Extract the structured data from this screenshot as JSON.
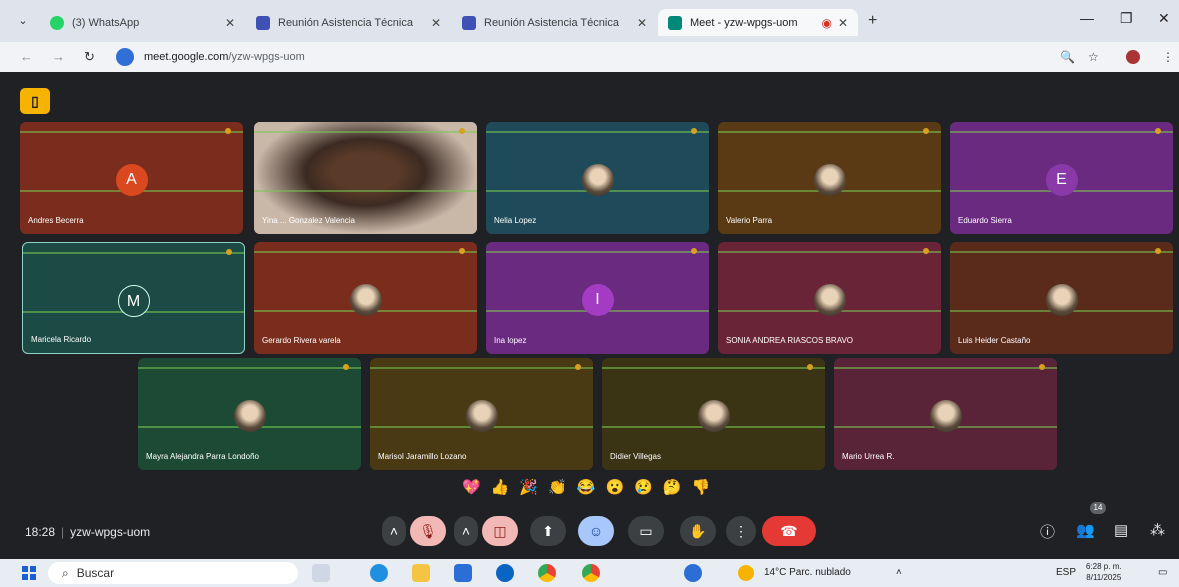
{
  "browser": {
    "tabs": [
      {
        "label": "(3) WhatsApp",
        "icon": "whatsapp-icon",
        "color": "#25d366"
      },
      {
        "label": "Reunión Asistencia Técnica",
        "icon": "calendar-icon",
        "color": "#3f51b5"
      },
      {
        "label": "Reunión Asistencia Técnica",
        "icon": "calendar-icon",
        "color": "#3f51b5"
      },
      {
        "label": "Meet - yzw-wpgs-uom",
        "icon": "meet-icon",
        "color": "#00897b"
      }
    ],
    "new_tab_label": "+",
    "url_domain": "meet.google.com",
    "url_path": "/yzw-wpgs-uom"
  },
  "meeting": {
    "time": "18:28",
    "code": "yzw-wpgs-uom",
    "participant_count": "14",
    "participants": [
      {
        "name": "Andres Becerra",
        "initial": "A",
        "bg": "#7a2d1c",
        "avatar_bg": "#d9481f"
      },
      {
        "name": "Yina ... Gonzalez Valencia",
        "initial": "",
        "bg": "#b9a89a",
        "avatar_bg": ""
      },
      {
        "name": "Nelia Lopez",
        "initial": "",
        "bg": "#1f4a5a",
        "avatar_bg": ""
      },
      {
        "name": "Valerio Parra",
        "initial": "",
        "bg": "#5a3a14",
        "avatar_bg": ""
      },
      {
        "name": "Eduardo Sierra",
        "initial": "E",
        "bg": "#6a2a80",
        "avatar_bg": "#8a3aa8"
      },
      {
        "name": "Maricela Ricardo",
        "initial": "M",
        "bg": "#1c4a44",
        "avatar_bg": "#1c4a44"
      },
      {
        "name": "Gerardo Rivera varela",
        "initial": "",
        "bg": "#7a2d1c",
        "avatar_bg": ""
      },
      {
        "name": "Ina lopez",
        "initial": "I",
        "bg": "#6a2a80",
        "avatar_bg": "#a33cc2"
      },
      {
        "name": "SONIA ANDREA RIASCOS BRAVO",
        "initial": "",
        "bg": "#6a2438",
        "avatar_bg": ""
      },
      {
        "name": "Luis Heider Castaño",
        "initial": "",
        "bg": "#5a2a1a",
        "avatar_bg": ""
      },
      {
        "name": "Mayra Alejandra Parra Londoño",
        "initial": "",
        "bg": "#1c4a34",
        "avatar_bg": ""
      },
      {
        "name": "Marisol Jaramillo Lozano",
        "initial": "",
        "bg": "#4a3a14",
        "avatar_bg": ""
      },
      {
        "name": "Didier Villegas",
        "initial": "",
        "bg": "#3a3414",
        "avatar_bg": ""
      },
      {
        "name": "Mario Urrea R.",
        "initial": "",
        "bg": "#5a2438",
        "avatar_bg": ""
      }
    ],
    "reactions": [
      "💖",
      "👍",
      "🎉",
      "👏",
      "😂",
      "😮",
      "😢",
      "🤔",
      "👎"
    ]
  },
  "taskbar": {
    "search_label": "Buscar",
    "weather": "14°C  Parc. nublado",
    "lang": "ESP",
    "time": "6:28 p. m.",
    "date": "8/11/2025"
  }
}
